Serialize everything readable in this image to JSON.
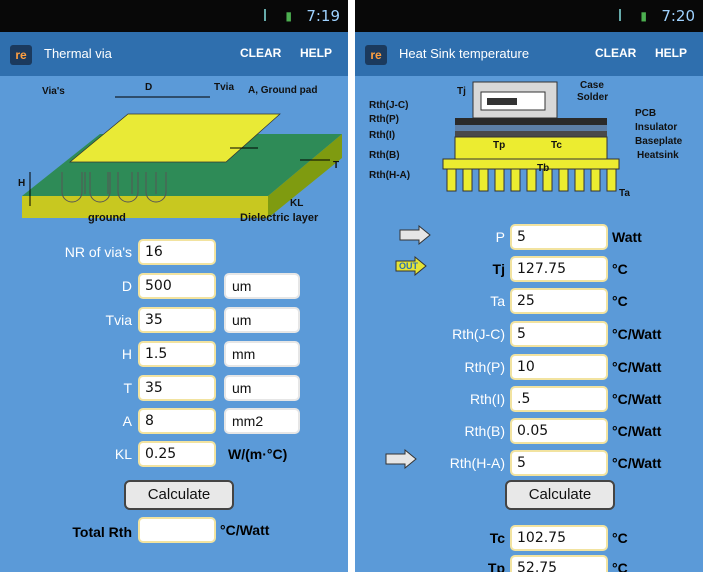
{
  "left": {
    "status_time": "7:19",
    "title": "Thermal via",
    "clear": "CLEAR",
    "help": "HELP",
    "diagram": {
      "vias": "Via's",
      "tvia": "Tvia",
      "d": "D",
      "ground_pad": "A, Ground pad",
      "h": "H",
      "t": "T",
      "kl": "KL",
      "ground": "ground",
      "dielectric": "Dielectric layer"
    },
    "fields": [
      {
        "label": "NR of via's",
        "value": "16"
      },
      {
        "label": "D",
        "value": "500",
        "unit": "um"
      },
      {
        "label": "Tvia",
        "value": "35",
        "unit": "um"
      },
      {
        "label": "H",
        "value": "1.5",
        "unit": "mm"
      },
      {
        "label": "T",
        "value": "35",
        "unit": "um"
      },
      {
        "label": "A",
        "value": "8",
        "unit": "mm2"
      },
      {
        "label": "KL",
        "value": "0.25",
        "unit": "W/(m·°C)"
      }
    ],
    "calculate": "Calculate",
    "total_label": "Total Rth",
    "total_value": "",
    "total_unit": "°C/Watt"
  },
  "right": {
    "status_time": "7:20",
    "title": "Heat Sink temperature",
    "clear": "CLEAR",
    "help": "HELP",
    "out_badge": "OUT",
    "diagram": {
      "tj": "Tj",
      "case": "Case",
      "solder": "Solder",
      "pcb": "PCB",
      "insulator": "Insulator",
      "baseplate": "Baseplate",
      "heatsink": "Heatsink",
      "ta": "Ta",
      "tp": "Tp",
      "tc": "Tc",
      "tb": "Tb",
      "rth_jc": "Rth(J-C)",
      "rth_p": "Rth(P)",
      "rth_i": "Rth(I)",
      "rth_b": "Rth(B)",
      "rth_ha": "Rth(H-A)"
    },
    "fields": [
      {
        "label": "P",
        "value": "5",
        "unit": "Watt"
      },
      {
        "label": "Tj",
        "value": "127.75",
        "unit": "°C"
      },
      {
        "label": "Ta",
        "value": "25",
        "unit": "°C"
      },
      {
        "label": "Rth(J-C)",
        "value": "5",
        "unit": "°C/Watt"
      },
      {
        "label": "Rth(P)",
        "value": "10",
        "unit": "°C/Watt"
      },
      {
        "label": "Rth(I)",
        "value": ".5",
        "unit": "°C/Watt"
      },
      {
        "label": "Rth(B)",
        "value": "0.05",
        "unit": "°C/Watt"
      },
      {
        "label": "Rth(H-A)",
        "value": "5",
        "unit": "°C/Watt"
      }
    ],
    "calculate": "Calculate",
    "results": [
      {
        "label": "Tc",
        "value": "102.75",
        "unit": "°C"
      },
      {
        "label": "Tp",
        "value": "52.75",
        "unit": "°C"
      }
    ]
  }
}
